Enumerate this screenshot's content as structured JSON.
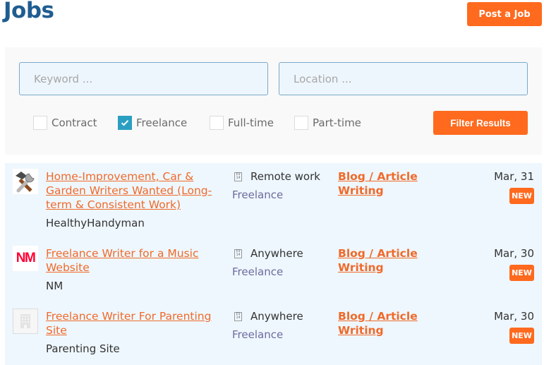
{
  "header": {
    "title": "Jobs",
    "post_button": "Post a Job"
  },
  "filters": {
    "keyword_placeholder": "Keyword ...",
    "keyword_value": "",
    "location_placeholder": "Location ...",
    "location_value": "",
    "job_types": [
      {
        "label": "Contract",
        "checked": false
      },
      {
        "label": "Freelance",
        "checked": true
      },
      {
        "label": "Full-time",
        "checked": false
      },
      {
        "label": "Part-time",
        "checked": false
      }
    ],
    "submit_label": "Filter Results"
  },
  "colors": {
    "accent": "#ff6a1e",
    "title": "#1f5d91",
    "checkbox_checked": "#2b9fc1",
    "list_bg": "#eef7fe"
  },
  "jobs": [
    {
      "logo": "tools-icon",
      "title": "Home-Improvement, Car & Garden Writers Wanted (Long-term & Consistent Work)",
      "company": "HealthyHandyman",
      "location": "Remote work",
      "type": "Freelance",
      "category": "Blog / Article Writing",
      "date": "Mar, 31",
      "badge": "NEW"
    },
    {
      "logo": "NM",
      "title": "Freelance Writer for a Music Website",
      "company": "NM",
      "location": "Anywhere",
      "type": "Freelance",
      "category": "Blog / Article Writing",
      "date": "Mar, 30",
      "badge": "NEW"
    },
    {
      "logo": "building-placeholder-icon",
      "title": "Freelance Writer For Parenting Site",
      "company": "Parenting Site",
      "location": "Anywhere",
      "type": "Freelance",
      "category": "Blog / Article Writing",
      "date": "Mar, 30",
      "badge": "NEW"
    }
  ]
}
